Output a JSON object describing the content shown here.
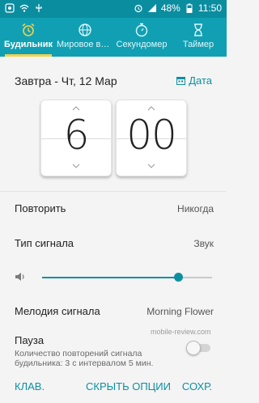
{
  "status_bar": {
    "battery_percent": "48%",
    "time": "11:50"
  },
  "tabs": [
    {
      "label": "Будильник",
      "icon": "alarm-icon",
      "active": true
    },
    {
      "label": "Мировое время",
      "icon": "globe-icon",
      "active": false
    },
    {
      "label": "Секундомер",
      "icon": "stopwatch-icon",
      "active": false
    },
    {
      "label": "Таймер",
      "icon": "hourglass-icon",
      "active": false
    }
  ],
  "date": {
    "text": "Завтра - Чт, 12 Мар",
    "button_label": "Дата"
  },
  "time_picker": {
    "hour": "6",
    "minute": "00"
  },
  "settings": {
    "repeat_label": "Повторить",
    "repeat_value": "Никогда",
    "signal_type_label": "Тип сигнала",
    "signal_type_value": "Звук",
    "volume_level": 0.8,
    "melody_label": "Мелодия сигнала",
    "melody_value": "Morning Flower",
    "pause_label": "Пауза",
    "pause_desc": "Количество повторений сигнала будильника: 3 с интервалом 5 мин.",
    "pause_enabled": false
  },
  "watermark": "mobile-review.com",
  "bottom_bar": {
    "left": "КЛАВ.",
    "center": "СКРЫТЬ ОПЦИИ",
    "right": "СОХР."
  },
  "colors": {
    "accent": "#0e8fa1",
    "tab_bar": "#11a0b3",
    "indicator": "#f3d24d"
  }
}
